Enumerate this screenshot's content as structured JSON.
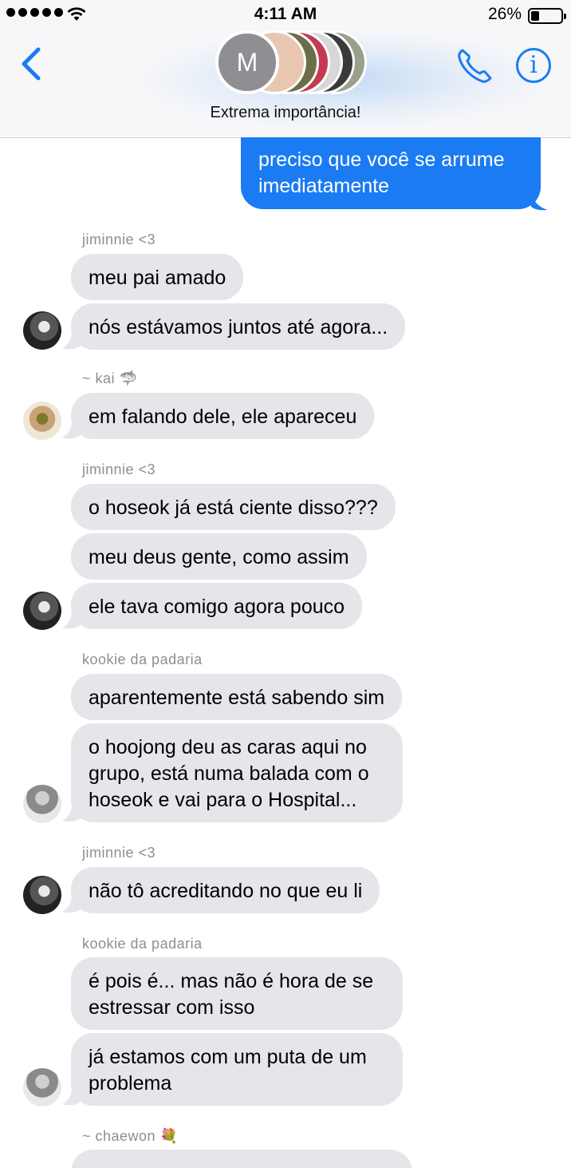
{
  "status_bar": {
    "time": "4:11 AM",
    "battery": "26%"
  },
  "header": {
    "group_initial": "M",
    "title": "Extrema importância!",
    "back_icon": "chevron-left-icon",
    "call_icon": "phone-icon",
    "info_icon": "info-icon",
    "info_glyph": "i"
  },
  "colors": {
    "accent": "#1a7bf2",
    "incoming_bubble": "#e5e5ea",
    "sender_label": "#8e8e93"
  },
  "messages": {
    "m0": {
      "text": "preciso que você se arrume imediatamente"
    },
    "s1": "jiminnie <3",
    "m1": {
      "text": "meu pai amado"
    },
    "m2": {
      "text": "nós estávamos juntos até agora..."
    },
    "s2": "~ kai 🦈",
    "m3": {
      "text": "em falando dele, ele apareceu"
    },
    "s3": "jiminnie <3",
    "m4": {
      "text": "o hoseok já está ciente disso???"
    },
    "m5": {
      "text": "meu deus gente, como assim"
    },
    "m6": {
      "text": "ele tava comigo agora pouco"
    },
    "s4": "kookie da padaria",
    "m7": {
      "text": "aparentemente está sabendo sim"
    },
    "m8": {
      "text": "o hoojong deu as caras aqui no grupo, está numa balada com o hoseok e vai para o Hospital..."
    },
    "s5": "jiminnie <3",
    "m9": {
      "text": "não tô acreditando no que eu li"
    },
    "s6": "kookie da padaria",
    "m10": {
      "text": "é pois é... mas não é hora de se estressar com isso"
    },
    "m11": {
      "text": "já estamos com um puta de um problema"
    },
    "s7": "~ chaewon 💐"
  }
}
